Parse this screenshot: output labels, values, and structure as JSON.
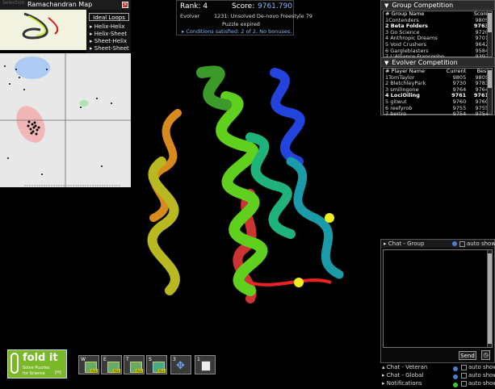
{
  "rama": {
    "faded_label": "Selection",
    "title": "Ramachandran Map",
    "ideal_loops": "Ideal Loops",
    "loops": [
      "Helix-Helix",
      "Helix-Sheet",
      "Sheet-Helix",
      "Sheet-Sheet"
    ]
  },
  "score": {
    "rank_label": "Rank: 4",
    "score_label": "Score:",
    "score_value": "9761.790",
    "mode": "Evolver",
    "puzzle": "1231: Unsolved De-novo Freestyle 79",
    "expired": "Puzzle expired",
    "conditions": "Conditions satisfied: 2 of 2, No bonuses."
  },
  "group_comp": {
    "title": "Group Competition",
    "headers": [
      "# Group Name",
      "Score"
    ],
    "rows": [
      {
        "name": "1Contenders",
        "score": "9805"
      },
      {
        "name": "2 Beta Folders",
        "score": "9763"
      },
      {
        "name": "3 Go Science",
        "score": "9720"
      },
      {
        "name": "4 Anthropic Dreams",
        "score": "9701"
      },
      {
        "name": "5 Void Crushers",
        "score": "9642"
      },
      {
        "name": "6 Gargleblasters",
        "score": "9584"
      },
      {
        "name": "7 L'Alliance Francopho...",
        "score": "9397"
      }
    ]
  },
  "evolver_comp": {
    "title": "Evolver Competition",
    "headers": [
      "# Player Name",
      "Current",
      "Best"
    ],
    "rows": [
      {
        "name": "1TomTaylor",
        "current": "9805",
        "best": "9805"
      },
      {
        "name": "2 BletchleyPark",
        "current": "9730",
        "best": "9783"
      },
      {
        "name": "3 smilingone",
        "current": "9764",
        "best": "9764"
      },
      {
        "name": "4 LociOiling",
        "current": "9761",
        "best": "9761"
      },
      {
        "name": "5 gitwut",
        "current": "9760",
        "best": "9760"
      },
      {
        "name": "6 reefyrob",
        "current": "9755",
        "best": "9755"
      },
      {
        "name": "7 bertro",
        "current": "9754",
        "best": "9754"
      }
    ]
  },
  "chat": {
    "group": "Chat - Group",
    "veteran": "Chat - Veteran",
    "global": "Chat - Global",
    "notifications": "Notifications",
    "auto_show": "auto show",
    "send": "Send"
  },
  "toolbar": {
    "buttons": [
      {
        "key": "W",
        "label": "ALL"
      },
      {
        "key": "E",
        "label": "ALL"
      },
      {
        "key": "T",
        "label": "ALL"
      },
      {
        "key": "S",
        "label": "ALL"
      },
      {
        "key": "3",
        "label": ""
      },
      {
        "key": "1",
        "label": ""
      }
    ]
  },
  "logo": {
    "title": "fold it",
    "tagline1": "Solve Puzzles",
    "tagline2": "for Science",
    "help": "[H]"
  },
  "colors": {
    "accent": "#7fb3ff",
    "panel": "#0a0a0a",
    "score_blue": "#8ab4ff"
  }
}
